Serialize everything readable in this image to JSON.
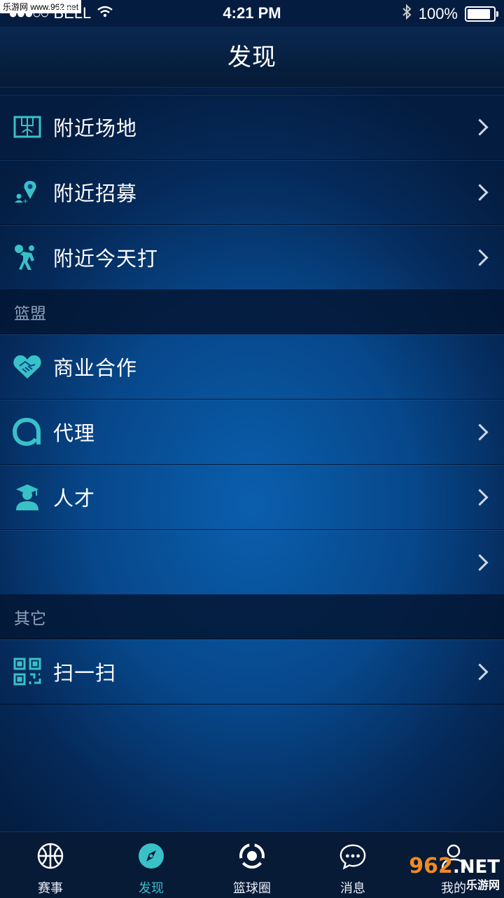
{
  "watermark": "乐游网 www.962.net",
  "status": {
    "carrier": "BELL",
    "time": "4:21 PM",
    "battery_pct": "100%",
    "battery_level": 1.0
  },
  "nav": {
    "title": "发现"
  },
  "list": {
    "nearby": [
      {
        "label": "附近场地",
        "icon": "court-icon"
      },
      {
        "label": "附近招募",
        "icon": "location-recruit-icon"
      },
      {
        "label": "附近今天打",
        "icon": "player-icon"
      }
    ],
    "section_league": "篮盟",
    "league": [
      {
        "label": "商业合作",
        "icon": "handshake-heart-icon"
      },
      {
        "label": "代理",
        "icon": "agent-icon"
      },
      {
        "label": "人才",
        "icon": "graduate-icon"
      },
      {
        "label": "",
        "icon": ""
      }
    ],
    "section_other": "其它",
    "other": [
      {
        "label": "扫一扫",
        "icon": "qr-code-icon"
      }
    ]
  },
  "tabs": [
    {
      "label": "赛事",
      "icon": "basketball-icon"
    },
    {
      "label": "发现",
      "icon": "compass-icon",
      "active": true
    },
    {
      "label": "篮球圈",
      "icon": "circle-icon"
    },
    {
      "label": "消息",
      "icon": "chat-icon"
    },
    {
      "label": "我的",
      "icon": "profile-icon"
    }
  ],
  "corner_logo": {
    "number": "962",
    "suffix": ".NET",
    "site": "乐游网"
  },
  "colors": {
    "accent": "#39c1c8",
    "background": "#07478a"
  }
}
